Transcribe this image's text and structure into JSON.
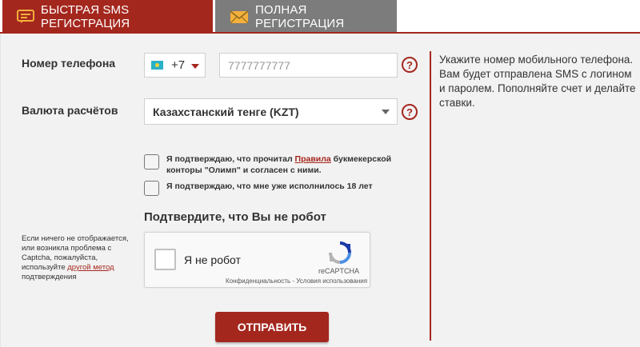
{
  "tabs": {
    "sms": {
      "label": "Быстрая SMS регистрация",
      "icon": "sms-chat-icon"
    },
    "full": {
      "label": "Полная регистрация",
      "icon": "envelope-icon"
    }
  },
  "form": {
    "phone": {
      "label": "Номер телефона",
      "country_flag": "kazakhstan-flag-icon",
      "country_code": "+7",
      "placeholder": "7777777777",
      "value": ""
    },
    "currency": {
      "label": "Валюта расчётов",
      "selected": "Казахстанский тенге (KZT)"
    },
    "help_glyph": "?",
    "checkbox_rules": {
      "text_before": "Я подтверждаю, что прочитал ",
      "link": "Правила",
      "text_after": " букмекерской конторы \"Олимп\" и согласен с ними.",
      "checked": false
    },
    "checkbox_age": {
      "text": "Я подтверждаю, что мне уже исполнилось 18 лет",
      "checked": false
    },
    "robot_title": "Подтвердите, что Вы не робот",
    "captcha_note": {
      "text_before": "Если ничего не отображается, или возникла проблема с Captcha, пожалуйста, используйте ",
      "link": "другой метод",
      "text_after": " подтверждения"
    },
    "captcha": {
      "label": "Я не робот",
      "brand": "reCAPTCHA",
      "links": "Конфиденциальность - Условия использования",
      "checked": false
    },
    "submit_label": "Отправить"
  },
  "info_text": "Укажите номер мобильного телефона. Вам будет отправлена SMS с логином и паролем. Пополняйте счет и делайте ставки.",
  "colors": {
    "accent": "#a4271e",
    "tab_inactive": "#7c7c7c",
    "panel_bg": "#f2f2f2"
  }
}
